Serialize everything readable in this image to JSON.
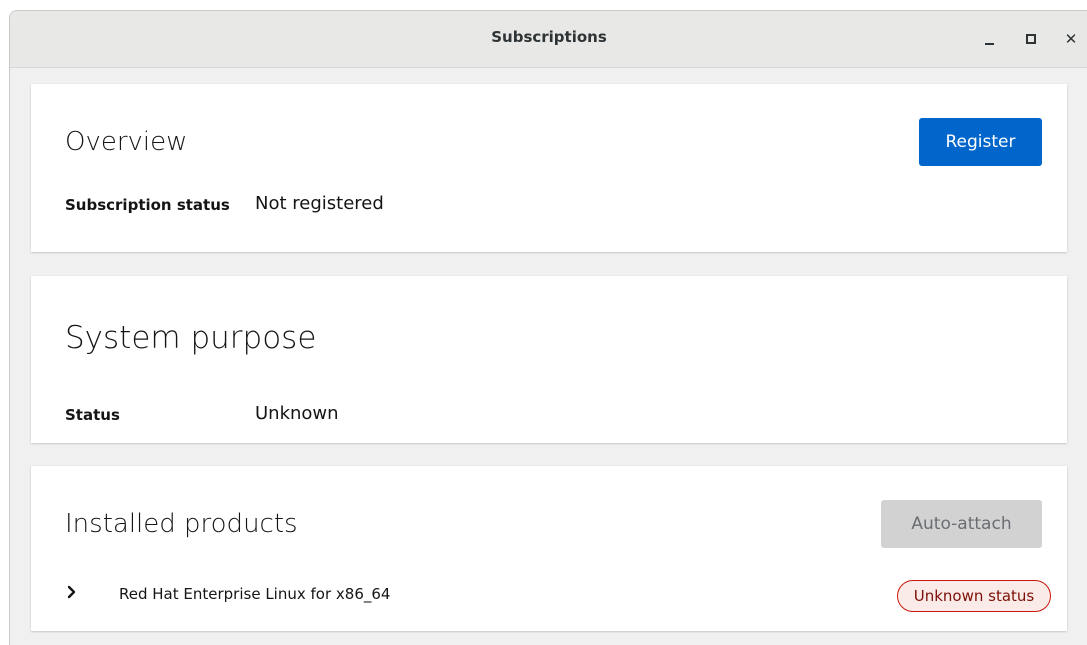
{
  "window": {
    "title": "Subscriptions",
    "controls": {
      "minimize": "minimize-icon",
      "maximize": "maximize-icon",
      "close": "close-icon"
    }
  },
  "overview": {
    "title": "Overview",
    "register_label": "Register",
    "subscription_status_label": "Subscription status",
    "subscription_status_value": "Not registered"
  },
  "system_purpose": {
    "title": "System purpose",
    "status_label": "Status",
    "status_value": "Unknown"
  },
  "installed_products": {
    "title": "Installed products",
    "auto_attach_label": "Auto-attach",
    "auto_attach_enabled": false,
    "products": [
      {
        "name": "Red Hat Enterprise Linux for x86_64",
        "status": "Unknown status",
        "expanded": false
      }
    ]
  },
  "colors": {
    "primary": "#0066cc",
    "disabled": "#d2d2d2",
    "danger_border": "#c9190b",
    "danger_text": "#7d1007",
    "danger_bg": "#faeae8"
  }
}
